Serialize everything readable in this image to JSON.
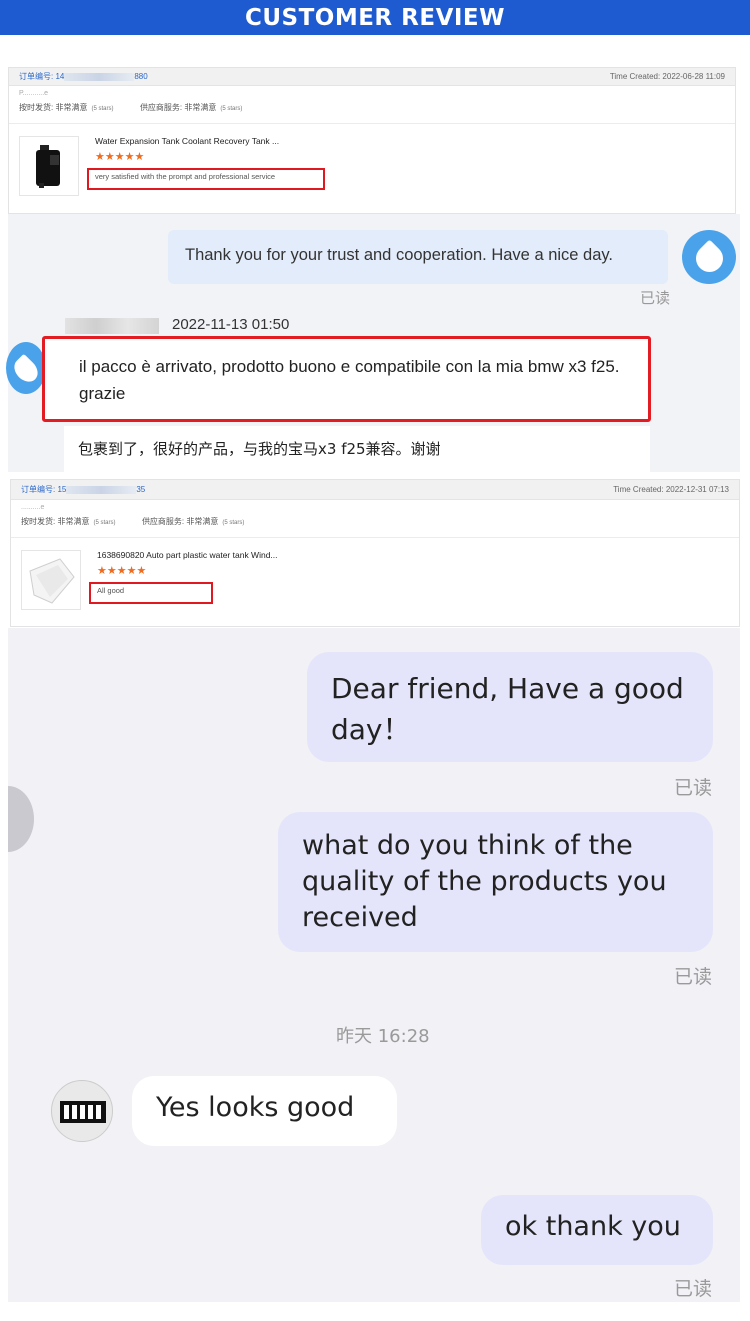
{
  "header": {
    "title": "CUSTOMER REVIEW"
  },
  "order1": {
    "order_label": "订单编号: 14",
    "order_tail": "880",
    "time_created": "Time Created: 2022-06-28 11:09",
    "buyer": "P...........e",
    "ship_label": "按时发货: 非常满意",
    "ship_stars": "(5 stars)",
    "service_label": "供应商服务: 非常满意",
    "service_stars": "(5 stars)",
    "product_name": "Water Expansion Tank Coolant Recovery Tank ...",
    "rating_stars": "★★★★★",
    "feedback": "very satisfied with the prompt and professional service"
  },
  "chat1": {
    "seller_msg": "Thank you for your trust and cooperation. Have a nice day.",
    "seller_read": "已读",
    "timestamp": "2022-11-13 01:50",
    "buyer_msg": "il pacco è arrivato, prodotto buono e compatibile con la mia bmw x3 f25. grazie",
    "translation": "包裹到了，很好的产品，与我的宝马x3 f25兼容。谢谢"
  },
  "order2": {
    "order_label": "订单编号: 15",
    "order_tail": "35",
    "time_created": "Time Created: 2022-12-31 07:13",
    "buyer": "..........e",
    "ship_label": "按时发货: 非常满意",
    "ship_stars": "(5 stars)",
    "service_label": "供应商服务: 非常满意",
    "service_stars": "(5 stars)",
    "product_name": "1638690820 Auto part plastic water tank Wind...",
    "rating_stars": "★★★★★",
    "feedback": "All good"
  },
  "chat2": {
    "msg1": "Dear friend, Have a good day！",
    "read1": "已读",
    "msg2": "what do you think of the quality of the products you received",
    "read2": "已读",
    "timestamp": "昨天 16:28",
    "reply": "Yes looks good",
    "msg3": "ok thank you",
    "read3": "已读"
  },
  "colors": {
    "header_bg": "#1e5bd0",
    "highlight": "#e31b23",
    "star": "#f26b1d",
    "bubble": "#e4e5fa"
  },
  "icons": [
    "water-drop-avatar-icon",
    "tire-avatar-icon",
    "star-icon"
  ]
}
